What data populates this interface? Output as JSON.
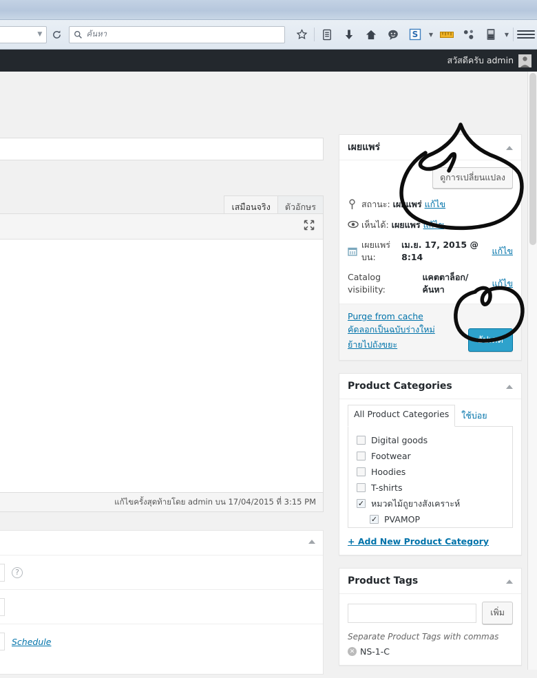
{
  "browser": {
    "search": {
      "placeholder": "ค้นหา",
      "icon": "search-icon"
    },
    "reload_icon": "reload-icon",
    "urlbar_caret_icon": "chevron-down-icon",
    "toolbar_icons": [
      {
        "name": "bookmark-star-icon",
        "label": "★"
      },
      {
        "name": "reading-list-icon",
        "label": "▤"
      },
      {
        "name": "downloads-icon",
        "label": "↓"
      },
      {
        "name": "home-icon",
        "label": "⌂"
      },
      {
        "name": "chat-bubble-icon",
        "label": "☺"
      },
      {
        "name": "skype-s-icon",
        "label": "S"
      },
      {
        "name": "skype-dropdown-icon",
        "label": "▾"
      },
      {
        "name": "ruler-measure-icon",
        "label": "▬"
      },
      {
        "name": "share-nodes-icon",
        "label": "⚯"
      },
      {
        "name": "trash-shredder-icon",
        "label": "▥"
      },
      {
        "name": "overflow-dropdown-icon",
        "label": "▾"
      },
      {
        "name": "menu-hamburger-icon",
        "label": "≡"
      }
    ]
  },
  "adminbar": {
    "howdy": "สวัสดีครับ admin",
    "avatar_icon": "user-avatar-icon"
  },
  "editor": {
    "tabs": [
      {
        "label": "เสมือนจริง",
        "active": true
      },
      {
        "label": "ตัวอักษร",
        "active": false
      }
    ],
    "fullscreen_icon": "fullscreen-expand-icon",
    "last_edited": "แก้ไขครั้งสุดท้ายโดย admin บน 17/04/2015 ที่ 3:15 PM"
  },
  "lower_box": {
    "toggle_icon": "chevron-up-icon",
    "help_icon": "help-circle-icon",
    "schedule_link": "Schedule"
  },
  "publish_box": {
    "title": "เผยแพร่",
    "toggle_icon": "chevron-up-icon",
    "view_changes_button": "ดูการเปลี่ยนแปลง",
    "rows": [
      {
        "icon": "pin-icon",
        "label": "สถานะ:",
        "value": "เผยแพร่",
        "edit": "แก้ไข"
      },
      {
        "icon": "eye-icon",
        "label": "เห็นได้:",
        "value": "เผยแพร่",
        "edit": "แก้ไข"
      },
      {
        "icon": "calendar-icon",
        "label": "เผยแพร่บน:",
        "value": "เม.ย. 17, 2015 @ 8:14",
        "edit": "แก้ไข"
      }
    ],
    "catalog_visibility": {
      "label": "Catalog visibility:",
      "value": "แคตตาล็อก/ค้นหา",
      "edit": "แก้ไข"
    },
    "purge_link": "Purge from cache",
    "copy_draft_link": "คัดลอกเป็นฉบับร่างใหม่",
    "trash_link": "ย้ายไปถังขยะ",
    "update_button": "อัปเดต",
    "update_button_color": "#2ea2cc"
  },
  "product_categories": {
    "title": "Product Categories",
    "toggle_icon": "chevron-up-icon",
    "tabs": [
      {
        "label": "All Product Categories",
        "active": true
      },
      {
        "label": "ใช้บ่อย",
        "active": false
      }
    ],
    "items": [
      {
        "label": "Digital goods",
        "checked": false,
        "child": false
      },
      {
        "label": "Footwear",
        "checked": false,
        "child": false
      },
      {
        "label": "Hoodies",
        "checked": false,
        "child": false
      },
      {
        "label": "T-shirts",
        "checked": false,
        "child": false
      },
      {
        "label": "หมวดไม้ถูยางสังเคราะห์",
        "checked": true,
        "child": false
      },
      {
        "label": "PVAMOP",
        "checked": true,
        "child": true
      }
    ],
    "add_new_link": "+ Add New Product Category"
  },
  "product_tags": {
    "title": "Product Tags",
    "toggle_icon": "chevron-up-icon",
    "input_value": "",
    "add_button": "เพิ่ม",
    "hint": "Separate Product Tags with commas",
    "tags": [
      {
        "label": "NS-1-C",
        "remove_icon": "remove-x-icon"
      }
    ]
  },
  "annotations": {
    "shape_1": "hand-drawn-circle-around-view-changes",
    "shape_2": "hand-drawn-circle-around-update-button",
    "color": "#0d0d0d"
  },
  "theme": {
    "adminbar_bg": "#23282d",
    "page_bg": "#f1f1f1",
    "link": "#0073aa",
    "danger": "#a00"
  }
}
